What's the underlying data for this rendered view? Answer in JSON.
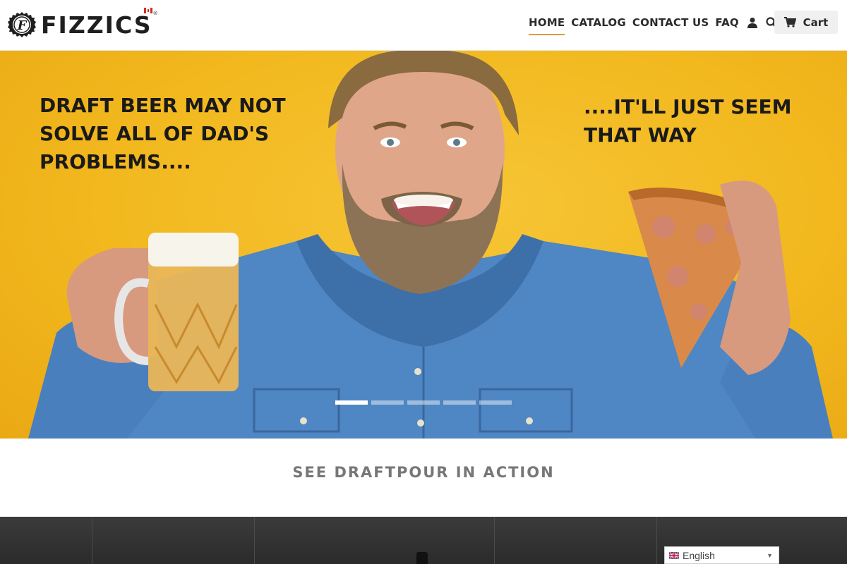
{
  "brand": {
    "name": "FIZZICS",
    "reg": "®"
  },
  "nav": {
    "items": [
      {
        "label": "HOME",
        "active": true
      },
      {
        "label": "CATALOG",
        "active": false
      },
      {
        "label": "CONTACT US",
        "active": false
      },
      {
        "label": "FAQ",
        "active": false
      }
    ],
    "icons": [
      "user-icon",
      "search-icon"
    ],
    "cart_label": "Cart"
  },
  "hero": {
    "headline_left": "DRAFT BEER MAY NOT SOLVE ALL OF DAD'S PROBLEMS....",
    "headline_right": "....IT'LL JUST SEEM THAT WAY",
    "slide_count": 5,
    "active_slide": 1,
    "background_color": "#f2b81e"
  },
  "section": {
    "title": "SEE DRAFTPOUR IN ACTION"
  },
  "language": {
    "selected": "English"
  },
  "colors": {
    "accent": "#e09c3a",
    "text": "#2b2b2b"
  }
}
